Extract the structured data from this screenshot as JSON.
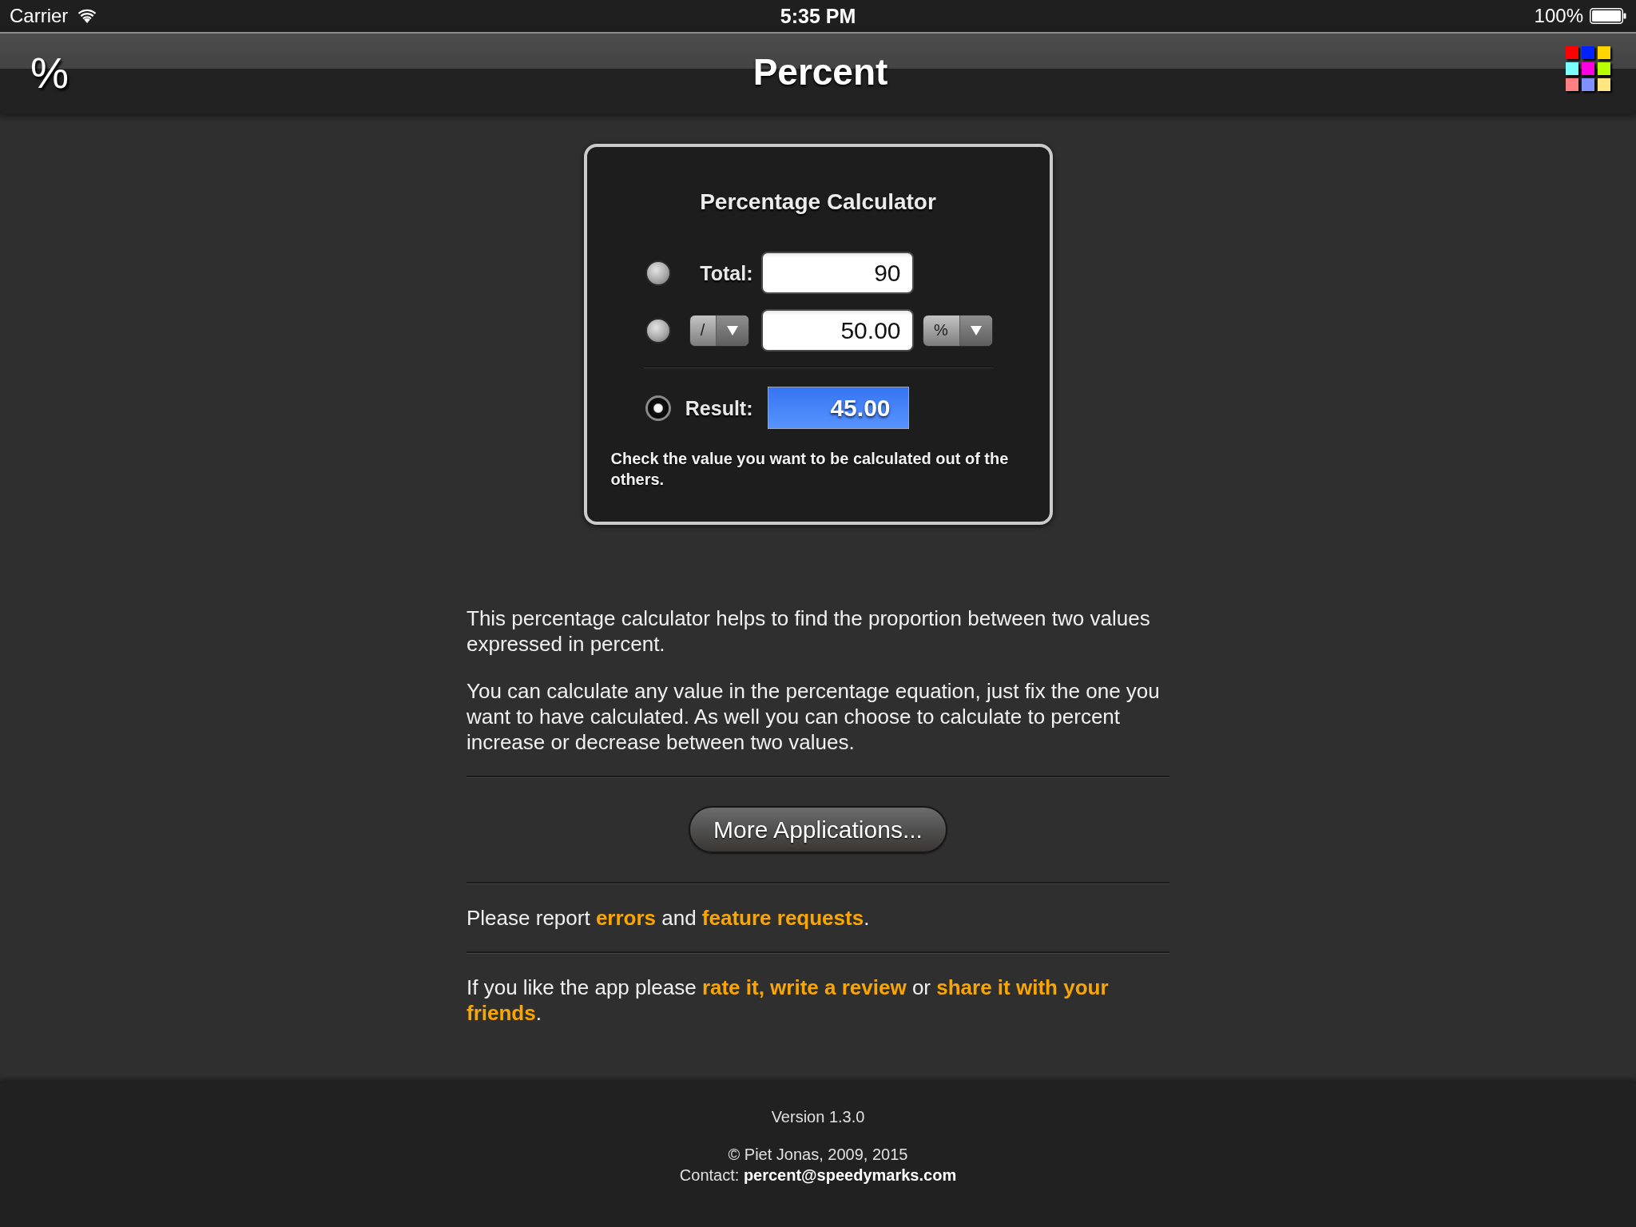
{
  "status_bar": {
    "carrier": "Carrier",
    "time": "5:35 PM",
    "battery": "100%"
  },
  "nav_bar": {
    "logo": "%",
    "title": "Percent"
  },
  "calculator": {
    "title": "Percentage Calculator",
    "rows": [
      {
        "kind": "field",
        "selected": false,
        "label": "Total:",
        "value": "90"
      },
      {
        "kind": "operator_field",
        "selected": false,
        "operator": "/",
        "value": "50.00",
        "unit": "%"
      },
      {
        "kind": "result",
        "selected": true,
        "label": "Result:",
        "value": "45.00"
      }
    ],
    "hint": "Check the value you want to be calculated out of the others."
  },
  "description": [
    "This percentage calculator helps to find the proportion between two values expressed in percent.",
    "You can calculate any value in the percentage equation, just fix the one you want to have calculated. As well you can choose to calculate to percent increase or decrease between two values."
  ],
  "more_button": {
    "label": "More Applications..."
  },
  "feedback": [
    {
      "kind": "text",
      "text": "Please report "
    },
    {
      "kind": "link",
      "text": "errors"
    },
    {
      "kind": "text",
      "text": " and "
    },
    {
      "kind": "link",
      "text": "feature requests"
    },
    {
      "kind": "text",
      "text": "."
    }
  ],
  "sharing": [
    {
      "kind": "text",
      "text": "If you like the app please "
    },
    {
      "kind": "link",
      "text": "rate it, write a review"
    },
    {
      "kind": "text",
      "text": " or "
    },
    {
      "kind": "link",
      "text": "share it with your"
    },
    {
      "kind": "link",
      "text": "friends"
    },
    {
      "kind": "text",
      "text": "."
    }
  ],
  "footer": {
    "version": "Version 1.3.0",
    "copyright": "© Piet Jonas, 2009, 2015",
    "contact": [
      {
        "kind": "text",
        "text": "Contact: "
      },
      {
        "kind": "link",
        "text": "percent@speedymarks.com"
      }
    ]
  }
}
